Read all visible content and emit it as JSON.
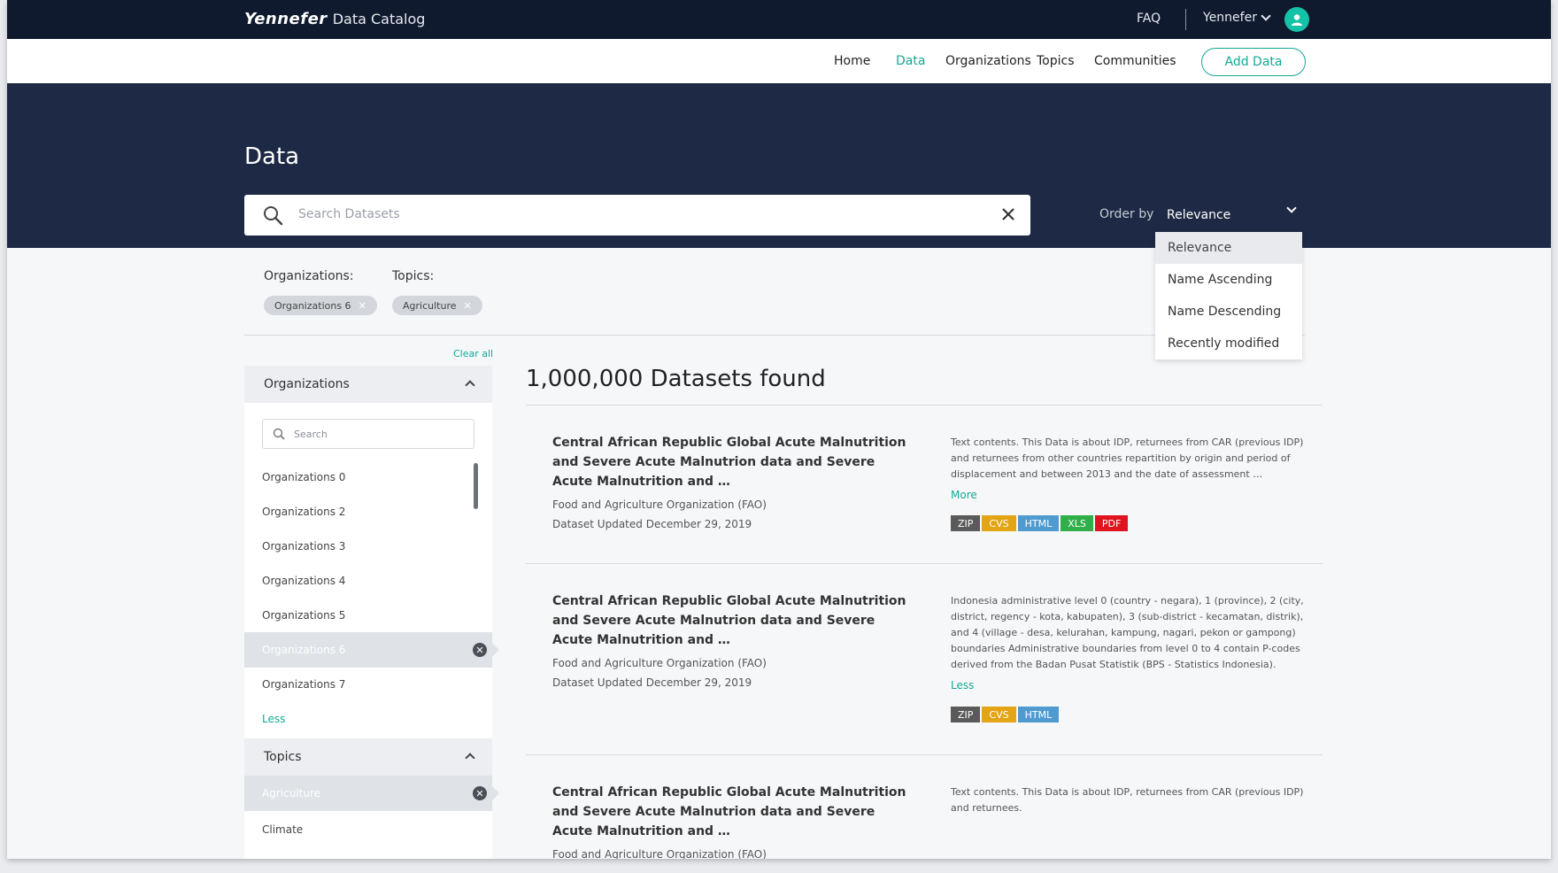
{
  "header": {
    "logo": "Yennefer",
    "app_name": "Data Catalog",
    "faq": "FAQ",
    "user_name": "Yennefer"
  },
  "nav": {
    "items": [
      {
        "label": "Home",
        "active": false
      },
      {
        "label": "Data",
        "active": true
      },
      {
        "label": "Organizations",
        "active": false
      },
      {
        "label": "Topics",
        "active": false
      },
      {
        "label": "Communities",
        "active": false
      }
    ],
    "add_data": "Add Data"
  },
  "hero": {
    "title": "Data",
    "search_placeholder": "Search Datasets",
    "order_label": "Order by",
    "order_value": "Relevance"
  },
  "order_options": [
    "Relevance",
    "Name Ascending",
    "Name Descending",
    "Recently modified"
  ],
  "filters": {
    "organizations_label": "Organizations:",
    "topics_label": "Topics:",
    "org_chip": "Organizations 6",
    "topic_chip": "Agriculture",
    "clear_all": "Clear all"
  },
  "sidebar": {
    "organizations": {
      "title": "Organizations",
      "search_placeholder": "Search",
      "items": [
        "Organizations 0",
        "Organizations 2",
        "Organizations 3",
        "Organizations 4",
        "Organizations 5",
        "Organizations 6",
        "Organizations 7"
      ],
      "selected": "Organizations 6",
      "less": "Less"
    },
    "topics": {
      "title": "Topics",
      "selected": "Agriculture",
      "items": [
        "Climate"
      ]
    }
  },
  "results": {
    "count_text": "1,000,000 Datasets found",
    "items": [
      {
        "title": "Central African Republic Global Acute Malnutrition and Severe Acute Malnutrion data and Severe Acute Malnutrition and …",
        "org": "Food and Agriculture Organization (FAO)",
        "updated": "Dataset Updated December 29, 2019",
        "desc": "Text contents. This Data is about IDP, returnees from CAR (previous IDP) and returnees from other countries repartition by origin and period of displacement and between 2013 and the date of assessment …",
        "toggle": "More",
        "tags": [
          "ZIP",
          "CVS",
          "HTML",
          "XLS",
          "PDF"
        ]
      },
      {
        "title": "Central African Republic Global Acute Malnutrition and Severe Acute Malnutrion data and Severe Acute Malnutrition and …",
        "org": "Food and Agriculture Organization (FAO)",
        "updated": "Dataset Updated December 29, 2019",
        "desc": "Indonesia administrative level 0 (country - negara), 1 (province), 2 (city, district, regency - kota, kabupaten), 3 (sub-district - kecamatan, distrik), and 4 (village - desa, kelurahan, kampung, nagari, pekon or gampong) boundaries Administrative boundaries from level 0 to 4 contain P-codes derived from the Badan Pusat Statistik (BPS - Statistics Indonesia).",
        "toggle": "Less",
        "tags": [
          "ZIP",
          "CVS",
          "HTML"
        ]
      },
      {
        "title": "Central African Republic Global Acute Malnutrition and Severe Acute Malnutrion data and Severe Acute Malnutrition and …",
        "org": "Food and Agriculture Organization (FAO)",
        "desc": "Text contents. This Data is about IDP, returnees from CAR (previous IDP) and returnees."
      }
    ]
  },
  "tag_colors": {
    "ZIP": "#5a5a5a",
    "CVS": "#e3a415",
    "HTML": "#4f9bd0",
    "XLS": "#2fae4a",
    "PDF": "#e0141e"
  },
  "colors": {
    "accent": "#14a896",
    "topbar": "#0f1a2e",
    "hero": "#1e2a45"
  }
}
